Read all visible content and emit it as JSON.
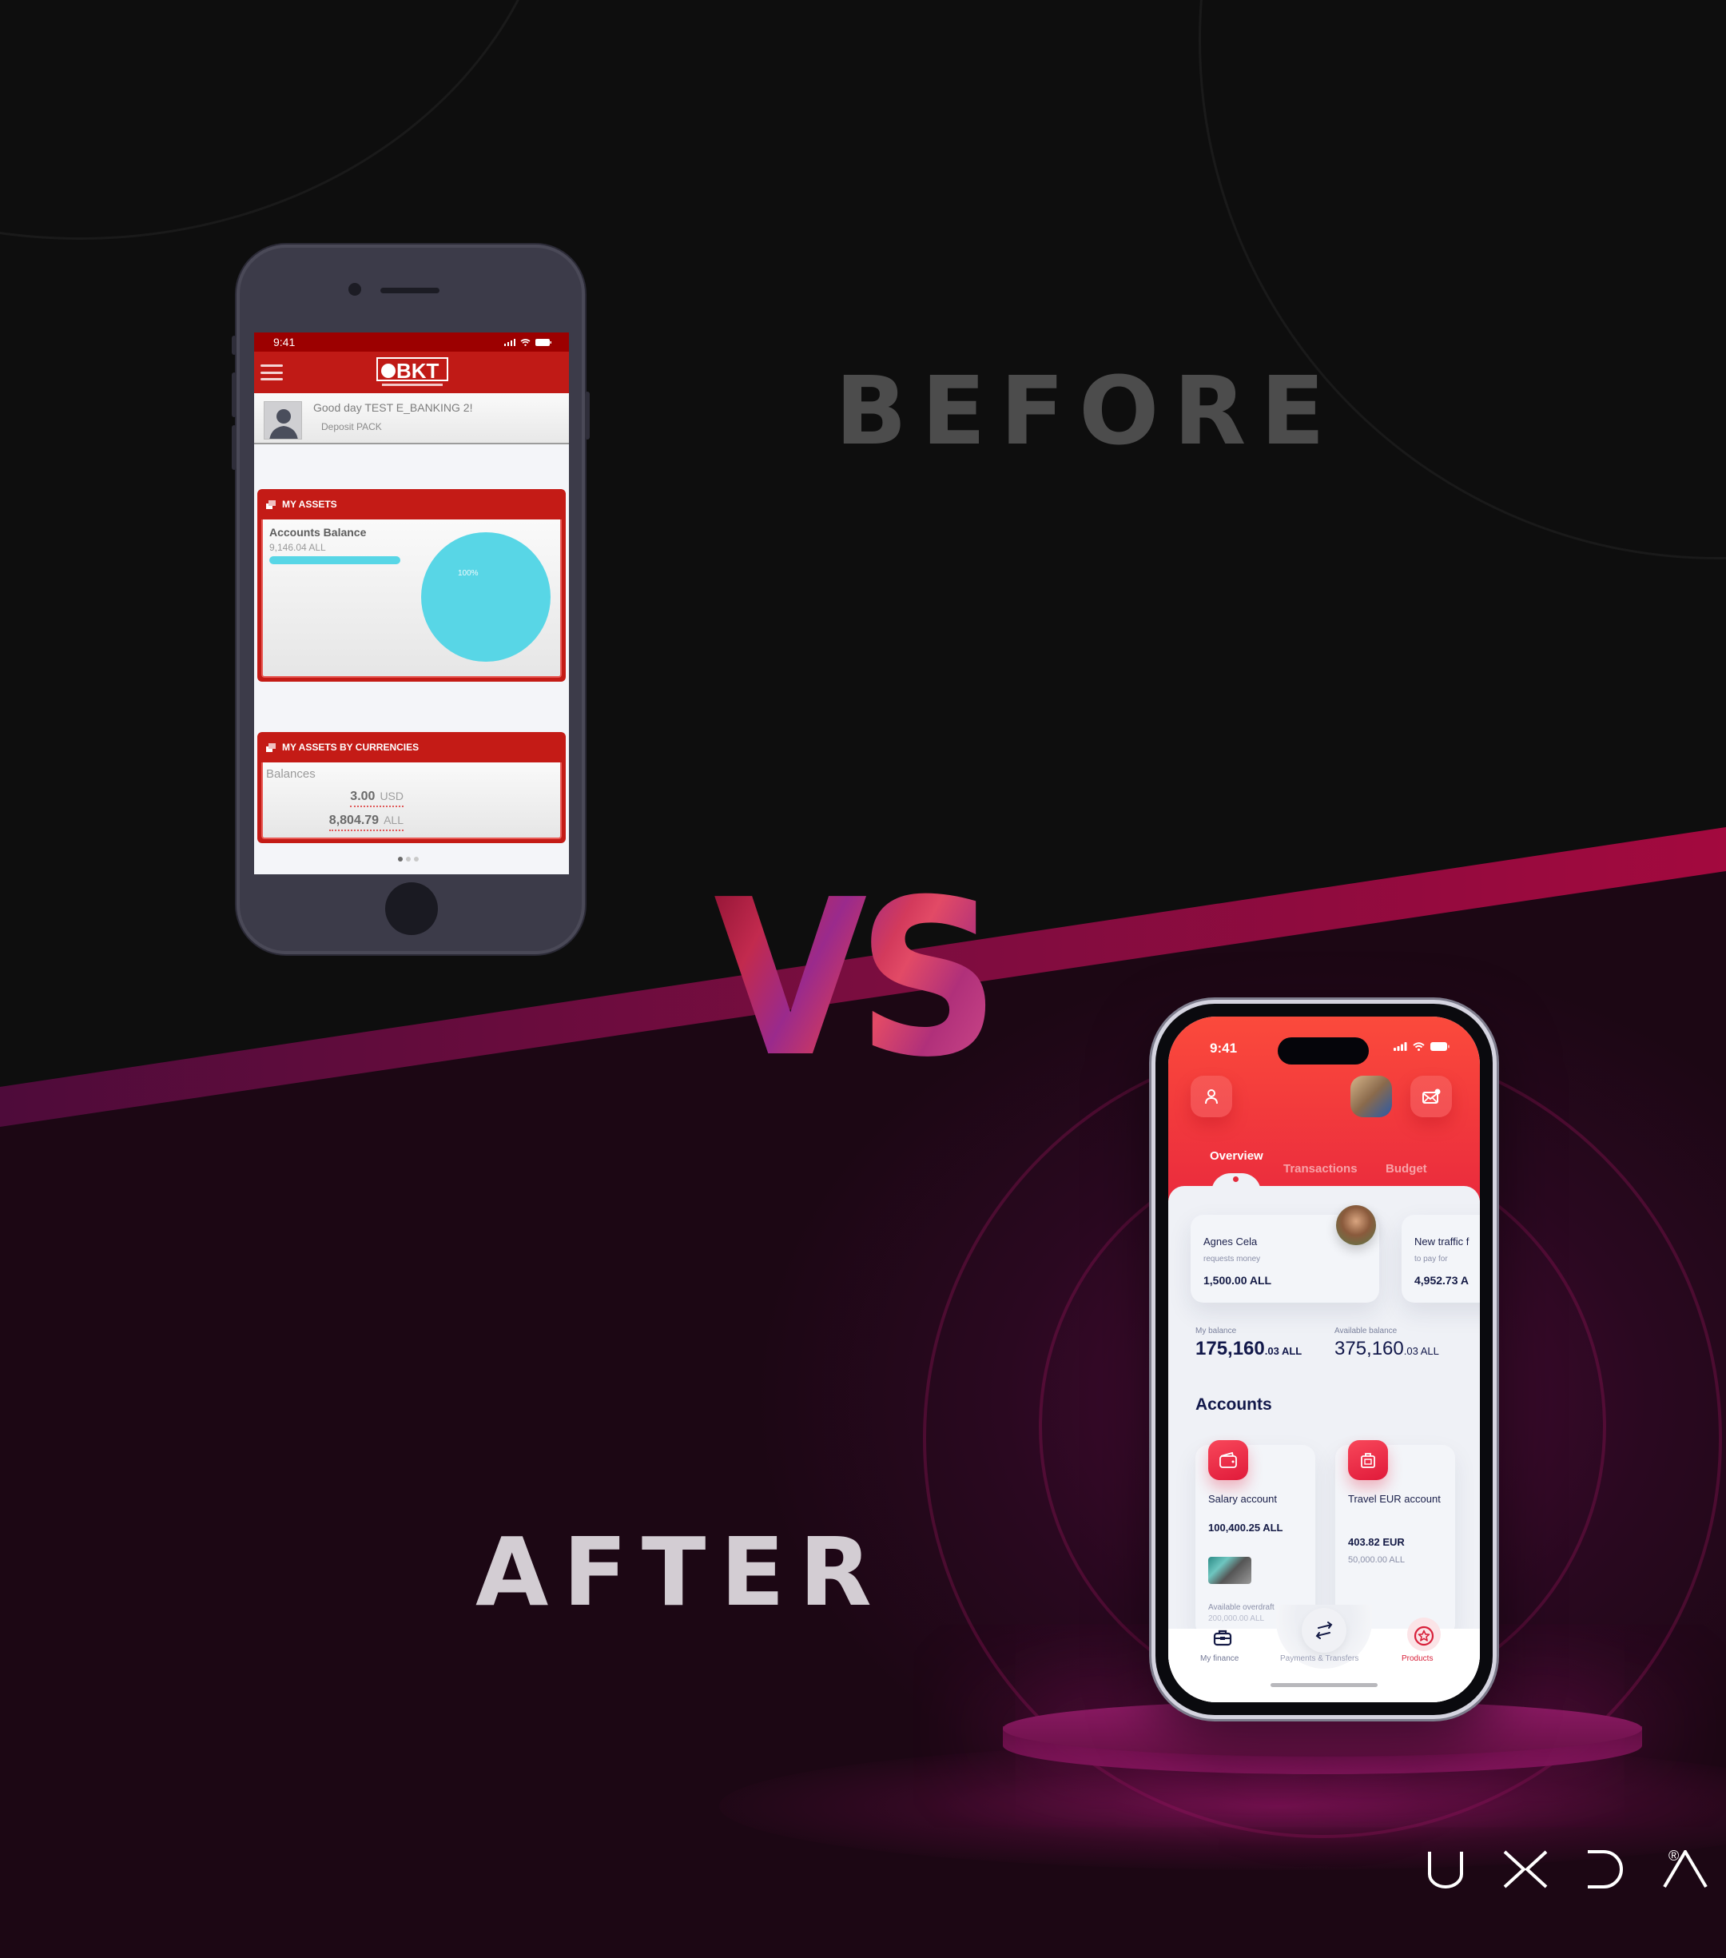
{
  "headings": {
    "before": "BEFORE",
    "versus": "VS",
    "after": "AFTER"
  },
  "brand": {
    "logo_letters": [
      "U",
      "X",
      "D",
      "A"
    ],
    "registered_mark": "®"
  },
  "colors": {
    "background_top": "#0e0e0e",
    "background_bottom": "#1e0612",
    "stripe": "#a3093e",
    "old_app_red": "#c41b16",
    "old_chart_cyan": "#58d6e6",
    "new_app_red": "#ea2b3d",
    "new_app_navy": "#12184a"
  },
  "old_app": {
    "status_time": "9:41",
    "logo_text": "BKT",
    "greeting": "Good day TEST E_BANKING 2!",
    "package": "Deposit PACK",
    "assets_card": {
      "title": "MY ASSETS",
      "accounts_balance_label": "Accounts Balance",
      "accounts_balance_value": "9,146.04 ALL",
      "pie_label": "100%",
      "pie_share": 1.0
    },
    "currencies_card": {
      "title": "MY ASSETS BY CURRENCIES",
      "balances_label": "Balances",
      "rows": [
        {
          "amount": "3.00",
          "currency": "USD"
        },
        {
          "amount": "8,804.79",
          "currency": "ALL"
        }
      ]
    },
    "page_indicator": {
      "pages": 3,
      "active": 1
    }
  },
  "new_app": {
    "status_time": "9:41",
    "tabs": [
      {
        "label": "Overview",
        "active": true
      },
      {
        "label": "Transactions",
        "active": false
      },
      {
        "label": "Budget",
        "active": false
      }
    ],
    "requests": [
      {
        "name": "Agnes Cela",
        "subtitle": "requests money",
        "amount": "1,500.00 ALL"
      },
      {
        "name": "New traffic f",
        "subtitle": "to pay for",
        "amount": "4,952.73 A"
      }
    ],
    "balances": {
      "my_balance_label": "My balance",
      "my_balance_main": "175,160",
      "my_balance_cents": ".03 ALL",
      "available_label": "Available balance",
      "available_main": "375,160",
      "available_cents": ".03 ALL"
    },
    "accounts_title": "Accounts",
    "accounts": [
      {
        "name": "Salary account",
        "amount": "100,400.25 ALL",
        "overdraft_label": "Available overdraft",
        "overdraft_value": "200,000.00 ALL"
      },
      {
        "name": "Travel EUR account",
        "amount": "403.82 EUR",
        "secondary": "50,000.00 ALL"
      }
    ],
    "nav": [
      {
        "label": "My finance",
        "active": false
      },
      {
        "label": "Payments & Transfers",
        "active": false
      },
      {
        "label": "Products",
        "active": true
      }
    ]
  }
}
